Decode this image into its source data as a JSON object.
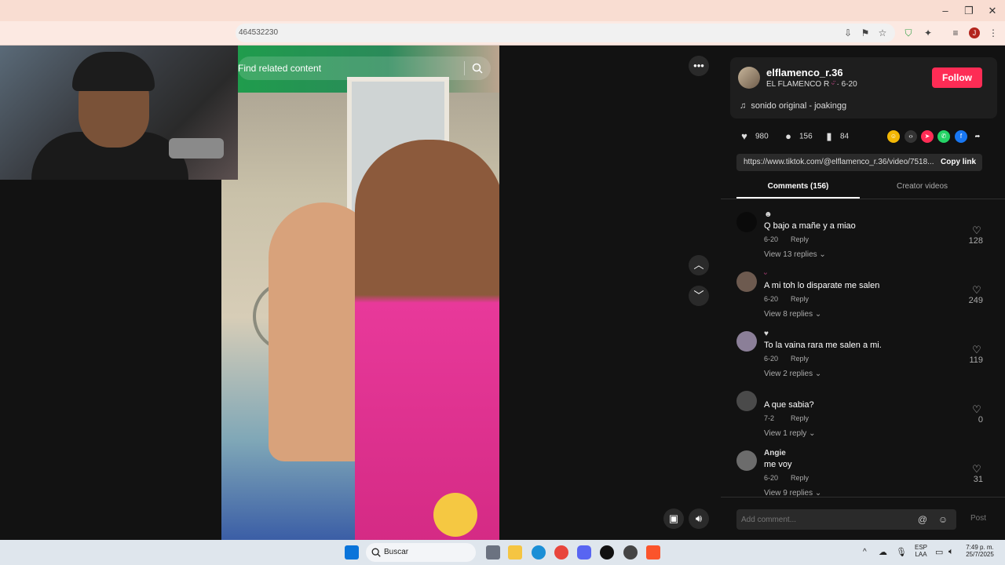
{
  "browser": {
    "url_fragment": "464532230"
  },
  "video": {
    "search_placeholder": "Find related content"
  },
  "creator": {
    "username": "elflamenco_r.36",
    "display_name": "EL FLAMENCO R",
    "date": "6-20",
    "follow_label": "Follow",
    "music": "sonido original - joakingg"
  },
  "stats": {
    "likes": "980",
    "comments": "156",
    "saves": "84"
  },
  "link": {
    "url": "https://www.tiktok.com/@elflamenco_r.36/video/7518...",
    "copy_label": "Copy link"
  },
  "tabs": {
    "comments": "Comments (156)",
    "creator_videos": "Creator videos"
  },
  "comments": [
    {
      "user": "",
      "text": "Q bajo a mañe y a miao",
      "date": "6-20",
      "reply": "Reply",
      "view_replies": "View 13 replies",
      "likes": "128"
    },
    {
      "user": "",
      "text": "A mi toh lo disparate me salen",
      "date": "6-20",
      "reply": "Reply",
      "view_replies": "View 8 replies",
      "likes": "249"
    },
    {
      "user": "",
      "text": "To la vaina rara me salen a mi.",
      "date": "6-20",
      "reply": "Reply",
      "view_replies": "View 2 replies",
      "likes": "119"
    },
    {
      "user": "",
      "text": "A que sabia?",
      "date": "7-2",
      "reply": "Reply",
      "view_replies": "View 1 reply",
      "likes": "0"
    },
    {
      "user": "Angie",
      "text": "me voy",
      "date": "6-20",
      "reply": "Reply",
      "view_replies": "View 9 replies",
      "likes": "31"
    }
  ],
  "add_comment": {
    "placeholder": "Add comment...",
    "post_label": "Post"
  },
  "taskbar": {
    "search_label": "Buscar",
    "lang": "ESP",
    "lang2": "LAA",
    "time": "7:49 p. m.",
    "date": "25/7/2025"
  },
  "colors": {
    "accent": "#fe2c55",
    "panel_bg": "#121212",
    "titlebar": "#f9ddd2"
  }
}
